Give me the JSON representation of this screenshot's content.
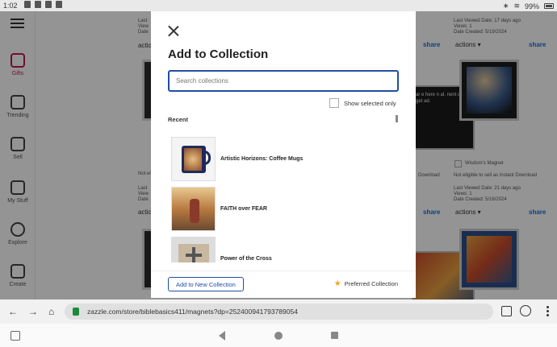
{
  "status_bar": {
    "time": "1:02",
    "battery": "99%"
  },
  "sidebar": {
    "items": [
      {
        "label": "Gifts",
        "icon": "gift-icon",
        "active": true
      },
      {
        "label": "Trending",
        "icon": "trending-icon",
        "active": false
      },
      {
        "label": "Sell",
        "icon": "store-icon",
        "active": false
      },
      {
        "label": "My Stuff",
        "icon": "folder-icon",
        "active": false
      },
      {
        "label": "Explore",
        "icon": "location-icon",
        "active": false
      },
      {
        "label": "Create",
        "icon": "pen-icon",
        "active": false
      }
    ]
  },
  "background": {
    "cards": [
      {
        "meta1": "Last",
        "meta2": "View",
        "meta3": "Date",
        "actions": "actic"
      },
      {
        "meta1": "Last Viewed Date: 17 days ago",
        "meta2": "Views: 1",
        "meta3": "Date Created: 5/19/2024",
        "actions": "actions",
        "share": "share"
      },
      {
        "meta1": "Last",
        "meta2": "View",
        "meta3": "Date",
        "actions": "actic"
      },
      {
        "meta1": "Last Viewed Date: 21 days ago",
        "meta2": "Views: 1",
        "meta3": "Date Created: 5/16/2024",
        "actions": "actions",
        "share": "share"
      }
    ],
    "partial_share_1": "share",
    "partial_share_2": "share",
    "not_eligible_left": "Not el",
    "not_eligible_mid": "Download",
    "not_eligible_right": "Not eligible to sell as Instant Download",
    "wisdom_label": "Wisdom's Magnet",
    "partial_art_text": "ar e here n al. nent ou get ad."
  },
  "modal": {
    "title": "Add to Collection",
    "search_placeholder": "Search collections",
    "show_selected_label": "Show selected only",
    "recent_label": "Recent",
    "collections": [
      {
        "name": "Artistic Horizons: Coffee Mugs"
      },
      {
        "name": "FAITH over FEAR"
      },
      {
        "name": "Power of the Cross"
      }
    ],
    "add_new_label": "Add to New Collection",
    "preferred_label": "Preferred Collection",
    "accent_color": "#1f4fa3",
    "star_color": "#f5a623"
  },
  "browser": {
    "url": "zazzle.com/store/biblebasics411/magnets?dp=252400941793789054"
  }
}
